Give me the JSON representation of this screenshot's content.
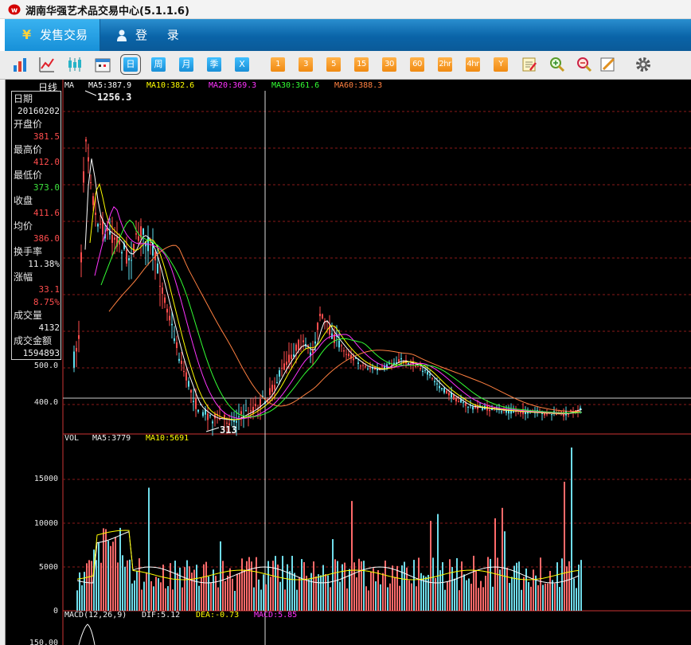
{
  "window": {
    "title": "湖南华强艺术品交易中心(5.1.1.6)"
  },
  "nav": {
    "sale_tab": "发售交易",
    "sale_icon": "yen-icon",
    "yen_symbol": "¥",
    "login_tab": "登 录",
    "login_icon": "user-icon"
  },
  "toolbar": {
    "icons": [
      "bar-chart-icon",
      "line-chart-icon",
      "candlestick-icon",
      "calendar-icon"
    ],
    "periods": [
      "日",
      "周",
      "月",
      "季",
      "X"
    ],
    "selected_period": "日",
    "intervals": [
      "1",
      "3",
      "5",
      "15",
      "30",
      "60",
      "2hr",
      "4hr",
      "Y"
    ],
    "tools": [
      "edit-icon",
      "zoom-in-icon",
      "zoom-out-icon",
      "draw-icon",
      "settings-icon"
    ]
  },
  "price_panel": {
    "period_label": "日线",
    "ma_title": "MA",
    "ma5": "MA5:387.9",
    "ma10": "MA10:382.6",
    "ma20": "MA20:369.3",
    "ma30": "MA30:361.6",
    "ma60": "MA60:388.3",
    "high_marker": "1256.3",
    "low_marker": "313",
    "y_ticks": [
      "500.0",
      "400.0"
    ],
    "colors": {
      "ma5": "#ffffff",
      "ma10": "#ffff00",
      "ma20": "#ff33ff",
      "ma30": "#33ff33",
      "ma60": "#ff8040"
    }
  },
  "info": {
    "date_label": "日期",
    "date": "20160202",
    "open_label": "开盘价",
    "open": "381.5",
    "high_label": "最高价",
    "high": "412.0",
    "low_label": "最低价",
    "low": "373.0",
    "close_label": "收盘",
    "close": "411.6",
    "avg_label": "均价",
    "avg": "386.0",
    "turnover_label": "换手率",
    "turnover": "11.38%",
    "change_label": "涨幅",
    "change": "33.1",
    "change_pct": "8.75%",
    "volume_label": "成交量",
    "volume": "4132",
    "amount_label": "成交金额",
    "amount": "1594893"
  },
  "volume_panel": {
    "title": "VOL",
    "ma5": "MA5:3779",
    "ma10": "MA10:5691",
    "y_ticks": [
      "15000",
      "10000",
      "5000",
      "0"
    ]
  },
  "macd_panel": {
    "title": "MACD(12,26,9)",
    "dif": "DIF:5.12",
    "dea": "DEA:-0.73",
    "macd": "MACD:5.85",
    "y_tick": "150.00"
  }
}
